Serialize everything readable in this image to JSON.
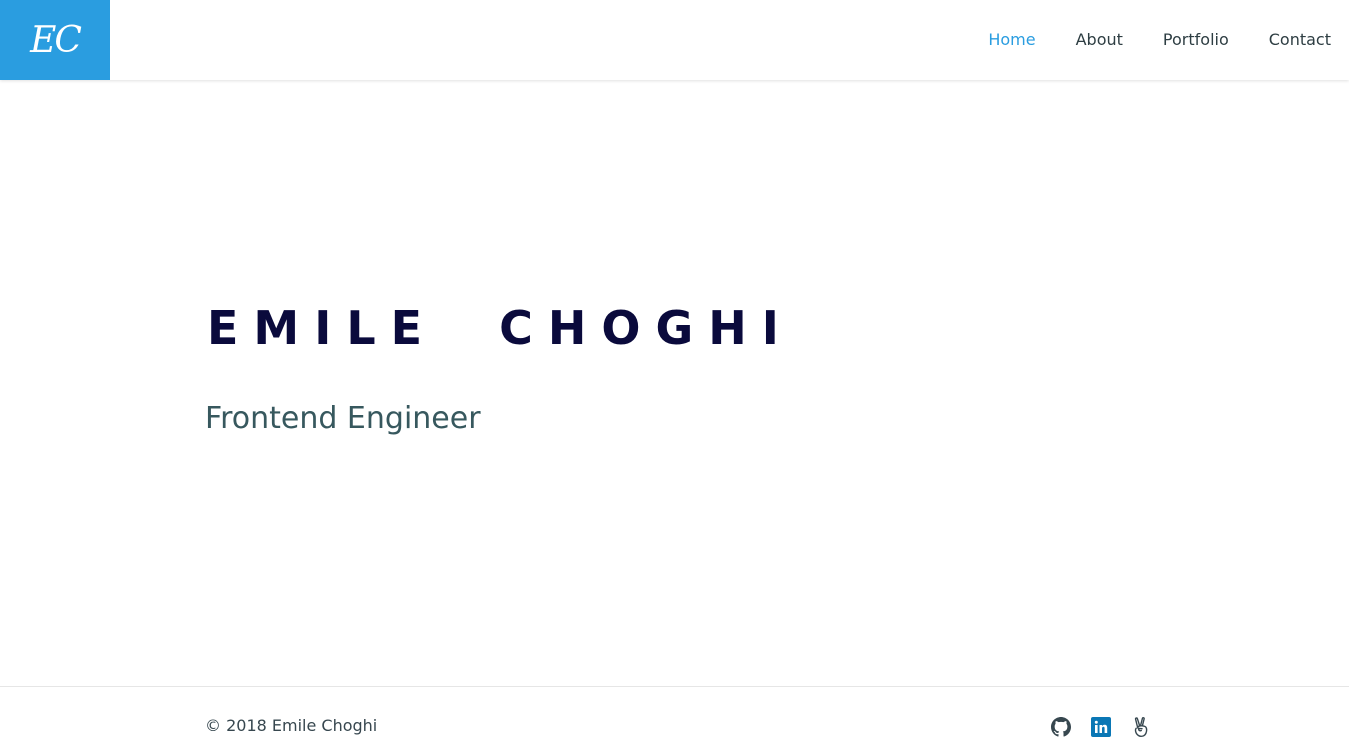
{
  "colors": {
    "accent": "#2a9de0",
    "nav_text": "#2e3e43",
    "name": "#0a0a3c",
    "role": "#37585e",
    "footer_text": "#37474f",
    "linkedin": "#0a77b5"
  },
  "header": {
    "logo_text": "EC",
    "nav": [
      {
        "label": "Home",
        "active": true
      },
      {
        "label": "About",
        "active": false
      },
      {
        "label": "Portfolio",
        "active": false
      },
      {
        "label": "Contact",
        "active": false
      }
    ]
  },
  "hero": {
    "name": "EMILE  CHOGHI",
    "role": "Frontend Engineer"
  },
  "footer": {
    "copyright": "© 2018 Emile Choghi",
    "social": [
      "github-icon",
      "linkedin-icon",
      "angellist-icon"
    ]
  }
}
